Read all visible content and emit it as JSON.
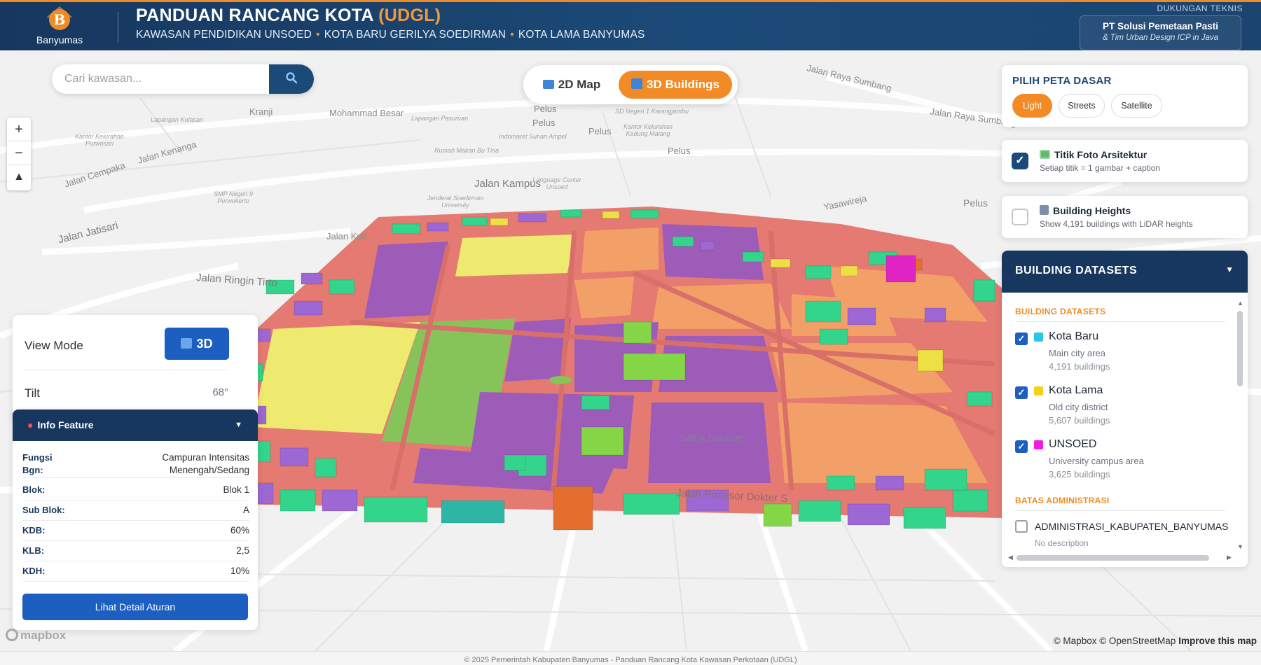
{
  "header": {
    "logo_text": "Banyumas",
    "logo_letter": "B",
    "title_main": "PANDUAN RANCANG KOTA ",
    "title_accent": "(UDGL)",
    "subtitle_1": "KAWASAN PENDIDIKAN UNSOED",
    "subtitle_2": "KOTA BARU GERILYA SOEDIRMAN",
    "subtitle_3": "KOTA LAMA BANYUMAS",
    "separator": "•",
    "support_label": "DUKUNGAN TEKNIS",
    "support_company": "PT Solusi Pemetaan Pasti",
    "support_team": "& Tim Urban Design ICP in Java"
  },
  "search": {
    "placeholder": "Cari kawasan...",
    "button_icon": "search-icon"
  },
  "mode_toggle": {
    "label_2d": "2D Map",
    "label_3d": "3D Buildings",
    "active": "3D Buildings"
  },
  "zoom": {
    "in": "+",
    "out": "−",
    "compass": "▲"
  },
  "basemap": {
    "title": "PILIH PETA DASAR",
    "options": [
      "Light",
      "Streets",
      "Satellite"
    ],
    "active": "Light"
  },
  "photos": {
    "checked": true,
    "title": "Titik Foto Arsitektur",
    "subtitle": "Setiap titik = 1 gambar + caption",
    "icon": "picture-icon"
  },
  "heights": {
    "checked": false,
    "title": "Building Heights",
    "subtitle": "Show 4,191 buildings with LiDAR heights",
    "icon": "building-icon"
  },
  "datasets": {
    "title": "BUILDING DATASETS",
    "section_1": "BUILDING DATASETS",
    "items": [
      {
        "name": "Kota Baru",
        "desc": "Main city area",
        "count": "4,191 buildings",
        "color": "#29c7e6",
        "checked": true
      },
      {
        "name": "Kota Lama",
        "desc": "Old city district",
        "count": "5,607 buildings",
        "color": "#f4d119",
        "checked": true
      },
      {
        "name": "UNSOED",
        "desc": "University campus area",
        "count": "3,625 buildings",
        "color": "#f21be0",
        "checked": true
      }
    ],
    "section_2": "BATAS ADMINISTRASI",
    "admin": {
      "name": "ADMINISTRASI_KABUPATEN_BANYUMAS",
      "desc": "No description",
      "checked": false
    }
  },
  "view_mode": {
    "label": "View Mode",
    "button": "3D",
    "tilt_label": "Tilt",
    "tilt_value": "68°"
  },
  "info_feature": {
    "title": "Info Feature",
    "rows": [
      {
        "key": "Fungsi Bgn:",
        "value": "Campuran Intensitas Menengah/Sedang"
      },
      {
        "key": "Blok:",
        "value": "Blok 1"
      },
      {
        "key": "Sub Blok:",
        "value": "A"
      },
      {
        "key": "KDB:",
        "value": "60%"
      },
      {
        "key": "KLB:",
        "value": "2,5"
      },
      {
        "key": "KDH:",
        "value": "10%"
      }
    ],
    "button": "Lihat Detail Aturan"
  },
  "map_labels": {
    "jalan_raya_sumbang_1": "Jalan Raya Sumbang",
    "jalan_raya_sumbang_2": "Jalan Raya Sumbang",
    "mohammad_besar": "Mohammad Besar",
    "kranji": "Kranji",
    "jalan_kenanga": "Jalan Kenanga",
    "jalan_cempaka": "Jalan Cempaka",
    "jalan_kampus": "Jalan Kampus",
    "jalan_jatisari": "Jalan Jatisari",
    "jalan_ringin_tirto": "Jalan Ringin Tirto",
    "jalan_kud": "Jalan Kud",
    "pelus_1": "Pelus",
    "pelus_2": "Pelus",
    "pelus_3": "Pelus",
    "pelus_4": "Pelus",
    "yasawireja": "Yasawireja",
    "satria_stadium": "Satria Stadium",
    "jalan_profesor": "Jalan Profesor Dokter S",
    "lapangan_kulasari": "Lapangan Kulasari",
    "lapangan_pasuruan": "Lapangan Pasuruan",
    "kantor_purwosari": "Kantor Kelurahan Purwosari",
    "rumah_makan": "Rumah Makan Bu Tina",
    "smp_negeri": "SMP Negeri 9 Purwokerto",
    "jenderal_soedirman": "Jenderal Soedirman University",
    "language_center": "Language Center Unsoed",
    "indomaret": "Indomaret Sunan Ampel",
    "kantor_kedung": "Kantor Kelurahan Kedung Malang",
    "sdn_karangjambu": "SD Negeri 1 Karangjambu"
  },
  "attribution": {
    "logo": "mapbox",
    "text": "© Mapbox © OpenStreetMap",
    "improve": "Improve this map"
  },
  "footer": "© 2025 Pemerintah Kabupaten Banyumas - Panduan Rancang Kota Kawasan Perkotaan (UDGL)"
}
